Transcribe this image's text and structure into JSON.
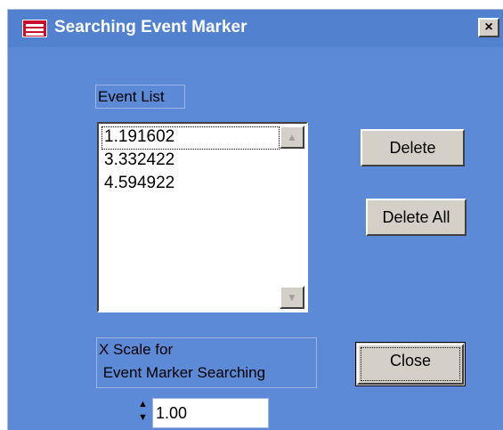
{
  "window": {
    "title": "Searching Event Marker",
    "close_glyph": "×",
    "colors": {
      "client": "#5d8ad6",
      "titlebar": "#5181cf",
      "button_face": "#d4d0c8"
    }
  },
  "event_list": {
    "label": "Event List",
    "items": [
      "1.191602",
      "3.332422",
      "4.594922"
    ],
    "selected_index": 0,
    "scroll_up_icon": "triangle-up-icon",
    "scroll_down_icon": "triangle-down-icon"
  },
  "buttons": {
    "delete": "Delete",
    "delete_all": "Delete All",
    "close": "Close"
  },
  "x_scale": {
    "label_line1": "X Scale for",
    "label_line2": " Event Marker Searching",
    "value": "1.00",
    "spinner_up": "▲",
    "spinner_down": "▼"
  }
}
